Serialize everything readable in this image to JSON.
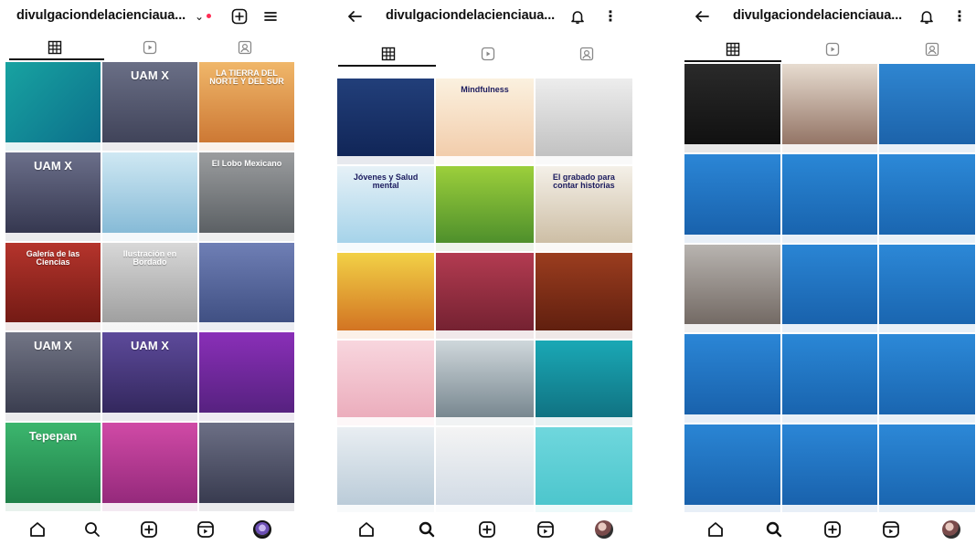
{
  "panels": [
    {
      "username": "divulgaciondelacienciaua...",
      "has_back": false,
      "cells": [
        {
          "bg": "linear-gradient(135deg,#18a3a1,#0b6d8a)",
          "text": ""
        },
        {
          "bg": "linear-gradient(180deg,#6a6f86,#3c3f55)",
          "text": "UAM X"
        },
        {
          "bg": "linear-gradient(180deg,#f0b76a,#c9722f)",
          "text": "LA TIERRA DEL NORTE Y DEL SUR"
        },
        {
          "bg": "linear-gradient(180deg,#6b6f8a,#30324a)",
          "text": "UAM X"
        },
        {
          "bg": "linear-gradient(180deg,#cfe8f3,#7fb6d4)",
          "text": ""
        },
        {
          "bg": "linear-gradient(180deg,#9b9d9f,#555a5e)",
          "text": "El Lobo Mexicano"
        },
        {
          "bg": "linear-gradient(180deg,#b5342c,#6d1812)",
          "text": "Galería de las Ciencias"
        },
        {
          "bg": "linear-gradient(180deg,#d8d8d8,#9a9a9a)",
          "text": "Ilustración en Bordado"
        },
        {
          "bg": "linear-gradient(180deg,#6f7fb5,#3b4b7e)",
          "text": ""
        },
        {
          "bg": "linear-gradient(180deg,#727585,#35384a)",
          "text": "UAM X"
        },
        {
          "bg": "linear-gradient(180deg,#5d4a9b,#2f2457)",
          "text": "UAM X"
        },
        {
          "bg": "linear-gradient(180deg,#8a2fb8,#51207a)",
          "text": ""
        },
        {
          "bg": "linear-gradient(180deg,#3cb66e,#1d7b45)",
          "text": "Tepepan"
        },
        {
          "bg": "linear-gradient(180deg,#d04aa6,#8f2677)",
          "text": ""
        },
        {
          "bg": "linear-gradient(180deg,#6c6f85,#33364a)",
          "text": ""
        }
      ]
    },
    {
      "username": "divulgaciondelacienciaua...",
      "has_back": true,
      "cells": [
        {
          "bg": "linear-gradient(180deg,#223f7a,#0f2354)",
          "text": ""
        },
        {
          "bg": "linear-gradient(180deg,#fbf1df,#f1c9a6)",
          "text": "Mindfulness",
          "dark": true
        },
        {
          "bg": "linear-gradient(180deg,#ededed,#bdbdbd)",
          "text": ""
        },
        {
          "bg": "linear-gradient(180deg,#e6f1f7,#9fd0e8)",
          "text": "Jóvenes y Salud mental",
          "dark": true
        },
        {
          "bg": "linear-gradient(180deg,#9ccf3b,#46892a)",
          "text": ""
        },
        {
          "bg": "linear-gradient(180deg,#f4f0e8,#c9b99e)",
          "text": "El grabado para contar historias",
          "dark": true
        },
        {
          "bg": "linear-gradient(180deg,#f2d146,#cf6a1f)",
          "text": ""
        },
        {
          "bg": "linear-gradient(180deg,#b33b51,#6e1f2e)",
          "text": ""
        },
        {
          "bg": "linear-gradient(180deg,#9b3d1f,#5a1c0d)",
          "text": ""
        },
        {
          "bg": "linear-gradient(180deg,#f8d6de,#eaa9b9)",
          "text": "",
          "dark": true
        },
        {
          "bg": "linear-gradient(180deg,#cfd7db,#6f7f88)",
          "text": ""
        },
        {
          "bg": "linear-gradient(180deg,#1aa8b5,#0f6d7d)",
          "text": ""
        },
        {
          "bg": "linear-gradient(180deg,#e9eef2,#b6c8d6)",
          "text": "",
          "dark": true
        },
        {
          "bg": "linear-gradient(180deg,#f4f4f4,#cfd9e4)",
          "text": "",
          "dark": true
        },
        {
          "bg": "linear-gradient(180deg,#6fd7dd,#49c4cb)",
          "text": ""
        }
      ]
    },
    {
      "username": "divulgaciondelacienciaua...",
      "has_back": true,
      "cells": [
        {
          "bg": "linear-gradient(180deg,#2a2a2a,#0e0e0e)",
          "text": ""
        },
        {
          "bg": "linear-gradient(180deg,#e7dcd0,#8b6a5b)",
          "text": ""
        },
        {
          "bg": "linear-gradient(180deg,#2f86d1,#1a5fa6)",
          "text": ""
        },
        {
          "bg": "linear-gradient(180deg,#2b86d6,#175ea8)",
          "text": ""
        },
        {
          "bg": "linear-gradient(180deg,#2a87d6,#1760aa)",
          "text": ""
        },
        {
          "bg": "linear-gradient(180deg,#2c89d8,#1862ac)",
          "text": ""
        },
        {
          "bg": "linear-gradient(180deg,#b8b4b0,#6c625c)",
          "text": ""
        },
        {
          "bg": "linear-gradient(180deg,#2a85d4,#175ea8)",
          "text": ""
        },
        {
          "bg": "linear-gradient(180deg,#2c88d7,#1862ac)",
          "text": ""
        },
        {
          "bg": "linear-gradient(180deg,#2b86d6,#175ea8)",
          "text": ""
        },
        {
          "bg": "linear-gradient(180deg,#2a87d6,#1760aa)",
          "text": ""
        },
        {
          "bg": "linear-gradient(180deg,#2c89d8,#1862ac)",
          "text": ""
        },
        {
          "bg": "linear-gradient(180deg,#2a85d4,#175ea8)",
          "text": ""
        },
        {
          "bg": "linear-gradient(180deg,#2b86d6,#175ea8)",
          "text": ""
        },
        {
          "bg": "linear-gradient(180deg,#2c88d7,#1862ac)",
          "text": ""
        }
      ]
    }
  ]
}
